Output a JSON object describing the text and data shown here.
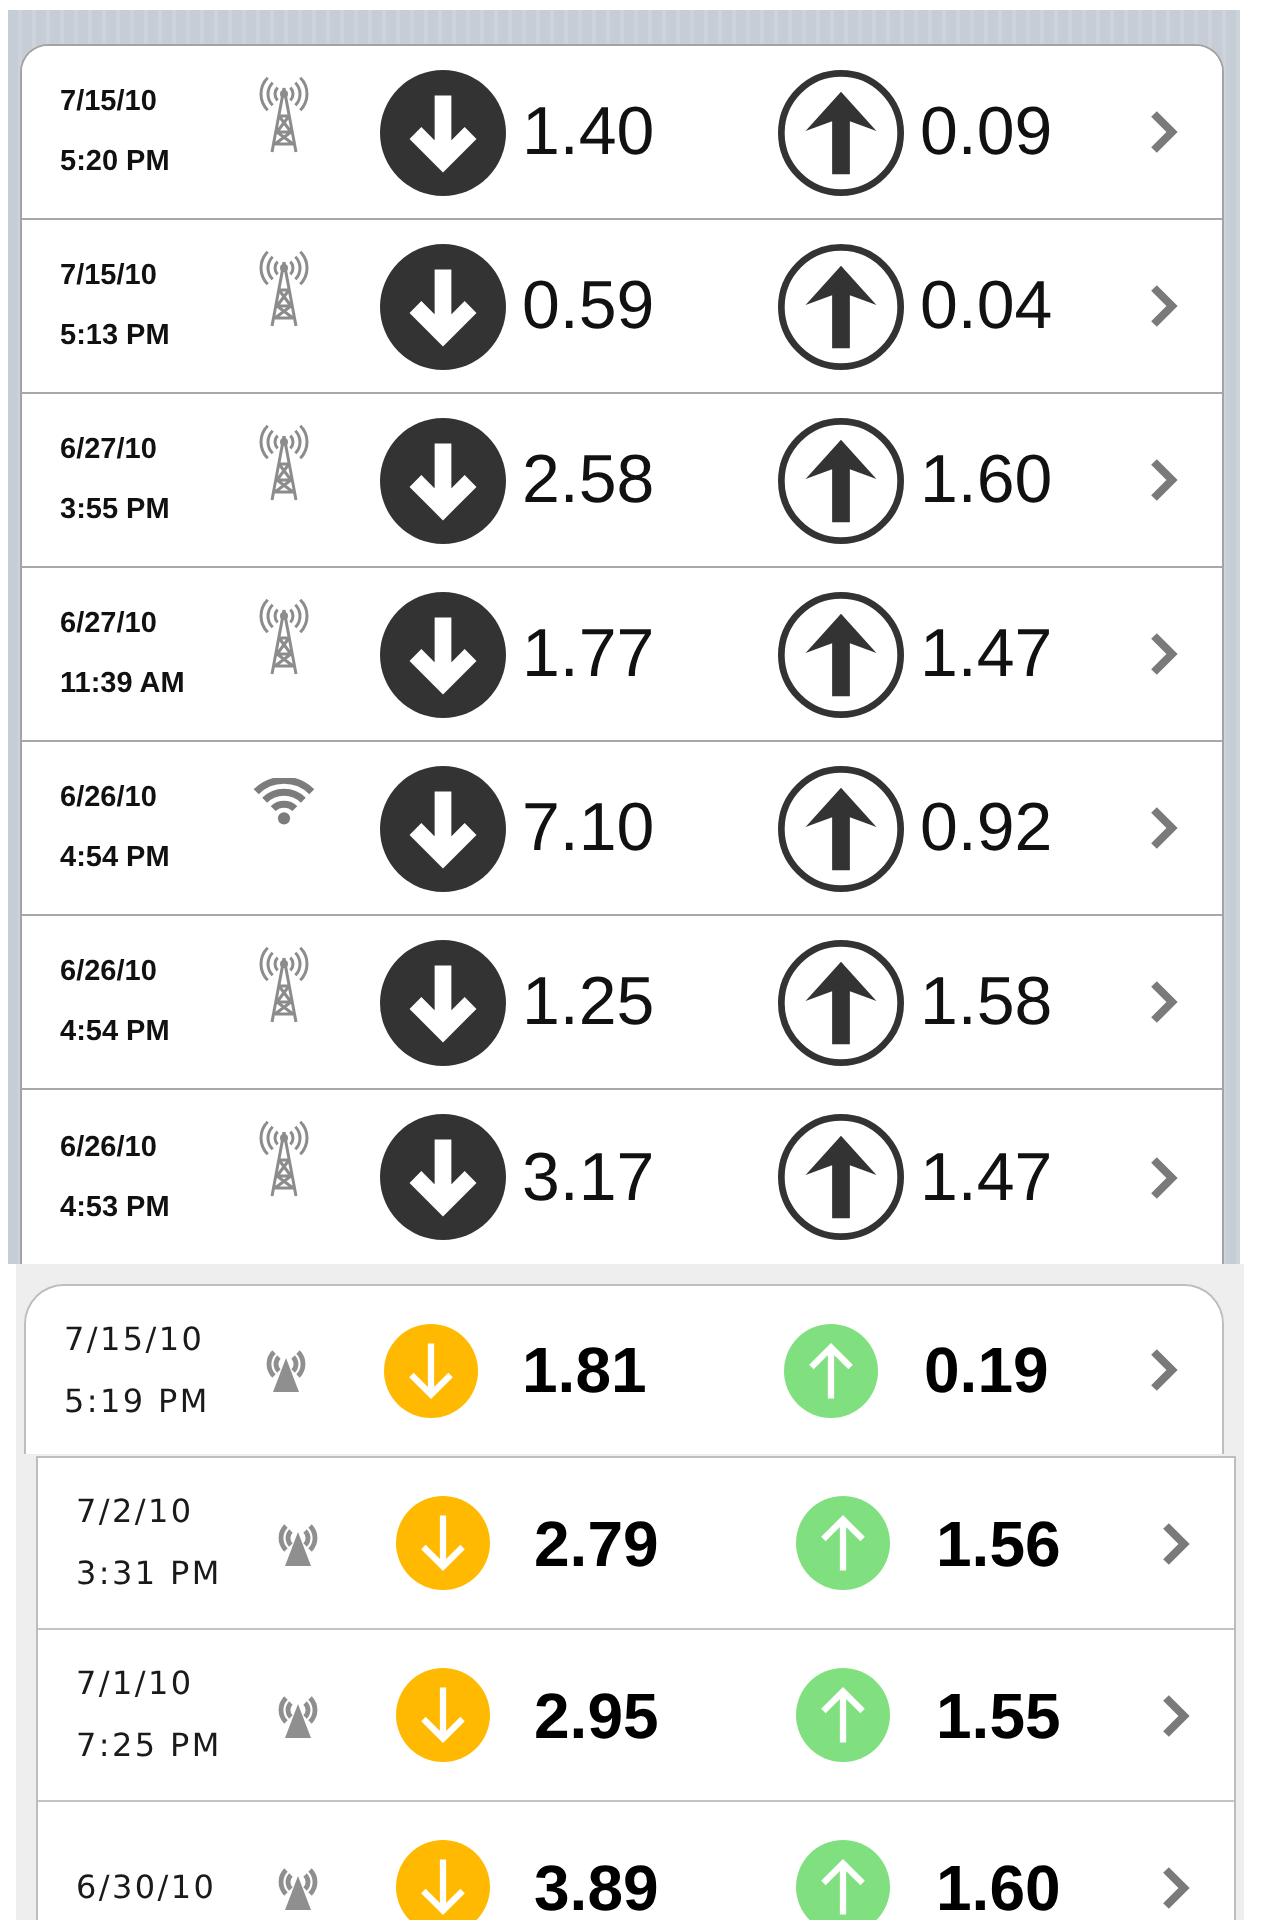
{
  "screens": [
    {
      "kind": "monochrome",
      "rows": [
        {
          "date": "7/15/10",
          "time": "5:20 PM",
          "kind": "cellular",
          "download": "1.40",
          "upload": "0.09"
        },
        {
          "date": "7/15/10",
          "time": "5:13 PM",
          "kind": "cellular",
          "download": "0.59",
          "upload": "0.04"
        },
        {
          "date": "6/27/10",
          "time": "3:55 PM",
          "kind": "cellular",
          "download": "2.58",
          "upload": "1.60"
        },
        {
          "date": "6/27/10",
          "time": "11:39 AM",
          "kind": "cellular",
          "download": "1.77",
          "upload": "1.47"
        },
        {
          "date": "6/26/10",
          "time": "4:54 PM",
          "kind": "wifi",
          "download": "7.10",
          "upload": "0.92"
        },
        {
          "date": "6/26/10",
          "time": "4:54 PM",
          "kind": "cellular",
          "download": "1.25",
          "upload": "1.58"
        },
        {
          "date": "6/26/10",
          "time": "4:53 PM",
          "kind": "cellular",
          "download": "3.17",
          "upload": "1.47"
        }
      ]
    },
    {
      "kind": "colored",
      "rows": [
        {
          "date": "7/15/10",
          "time": "5:19 PM",
          "kind": "cellular",
          "download": "1.81",
          "upload": "0.19"
        },
        {
          "date": "7/2/10",
          "time": "3:31 PM",
          "kind": "cellular",
          "download": "2.79",
          "upload": "1.56"
        },
        {
          "date": "7/1/10",
          "time": "7:25 PM",
          "kind": "cellular",
          "download": "2.95",
          "upload": "1.55"
        },
        {
          "date": "6/30/10",
          "kind": "cellular",
          "download": "3.89",
          "upload": "1.60"
        }
      ]
    }
  ]
}
